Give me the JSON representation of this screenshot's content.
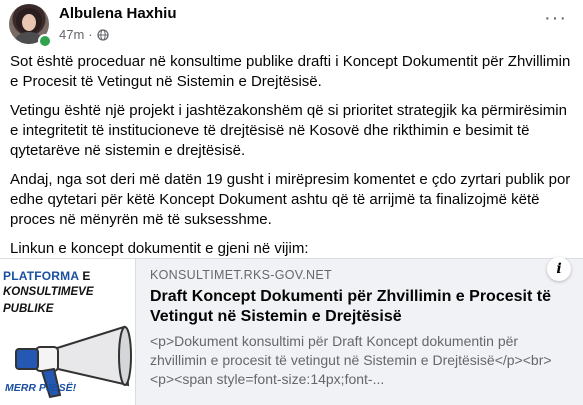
{
  "post": {
    "author": "Albulena Haxhiu",
    "time": "47m",
    "separator": "·",
    "audience_icon": "globe-icon",
    "more_label": "···",
    "paragraphs": [
      "Sot është proceduar në konsultime publike drafti i Koncept Dokumentit për Zhvillimin e Procesit të Vetingut në Sistemin e Drejtësisë.",
      "Vetingu është një projekt i jashtëzakonshëm që si prioritet strategjik ka përmirësimin e integritetit të institucioneve të drejtësisë në Kosovë dhe rikthimin e besimit të qytetarëve në sistemin e drejtësisë.",
      "Andaj, nga sot deri më datën 19 gusht i mirëpresim komentet e çdo zyrtari publik por edhe qytetari për këtë Koncept Dokument ashtu që të arrijmë ta finalizojmë këtë proces në mënyrën më të suksesshme.",
      "Linkun e koncept dokumentit e gjeni në vijim:"
    ]
  },
  "link": {
    "thumb_line1a": "PLATFORMA",
    "thumb_line1b": "E",
    "thumb_line2": "KONSULTIMEVE",
    "thumb_line3": "PUBLIKE",
    "thumb_line4": "MERR PJESË!",
    "domain": "KONSULTIMET.RKS-GOV.NET",
    "title": "Draft Koncept Dokumenti për Zhvillimin e Procesit të Vetingut në Sistemin e Drejtësisë",
    "description": "<p>Dokument konsultimi për Draft Koncept dokumentin për zhvillimin e procesit të vetingut në Sistemin e Drejtësisë</p><br><p><span style=font-size:14px;font-...",
    "info_label": "i"
  },
  "colors": {
    "accent": "#1a4fa0",
    "online": "#31a24c",
    "muted": "#65676b",
    "card_bg": "#f0f2f5"
  }
}
